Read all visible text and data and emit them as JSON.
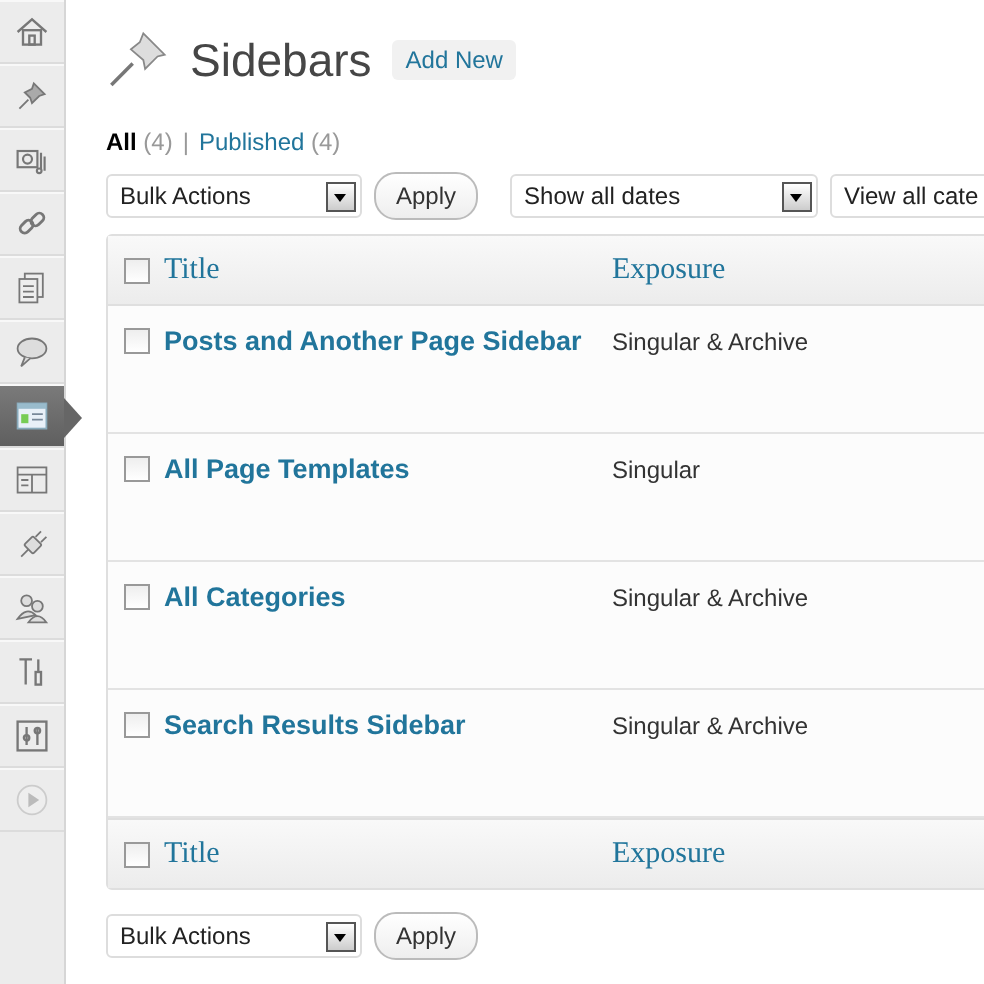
{
  "sidebar": {
    "items": [
      {
        "selected": false
      },
      {
        "selected": false
      },
      {
        "selected": false
      },
      {
        "selected": false
      },
      {
        "selected": false
      },
      {
        "selected": false
      },
      {
        "selected": true
      },
      {
        "selected": false
      },
      {
        "selected": false
      },
      {
        "selected": false
      },
      {
        "selected": false
      },
      {
        "selected": false
      },
      {
        "selected": false
      }
    ]
  },
  "page": {
    "title": "Sidebars",
    "add_new": "Add New"
  },
  "filters": [
    {
      "label": "All",
      "count": "(4)",
      "selected": true
    },
    {
      "separator": "|",
      "label": "Published",
      "count": "(4)",
      "selected": false
    }
  ],
  "top_actions": {
    "bulk": "Bulk Actions",
    "apply": "Apply",
    "dates": "Show all dates",
    "categories": "View all cate"
  },
  "table": {
    "columns": [
      "Title",
      "Exposure"
    ],
    "header_checked": false,
    "footer_checked": false,
    "rows": [
      {
        "title": "Posts and Another Page Sidebar",
        "exposure": "Singular & Archive",
        "checked": false
      },
      {
        "title": "All Page Templates",
        "exposure": "Singular",
        "checked": false
      },
      {
        "title": "All Categories",
        "exposure": "Singular & Archive",
        "checked": false
      },
      {
        "title": "Search Results Sidebar",
        "exposure": "Singular & Archive",
        "checked": false
      }
    ],
    "footer_columns": [
      "Title",
      "Exposure"
    ]
  },
  "bottom_actions": {
    "bulk": "Bulk Actions",
    "apply": "Apply"
  }
}
